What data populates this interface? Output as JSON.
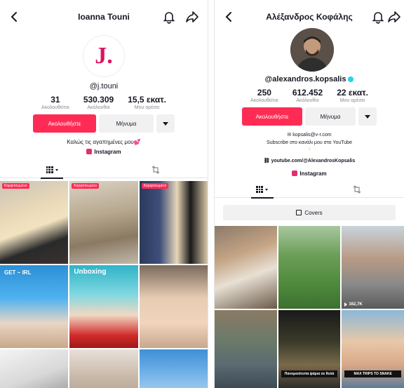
{
  "left": {
    "title": "Ioanna Touni",
    "avatar_letter": "J.",
    "handle": "@j.touni",
    "stats": [
      {
        "num": "31",
        "lbl": "Ακολουθείται"
      },
      {
        "num": "530.309",
        "lbl": "Ακόλουθοι"
      },
      {
        "num": "15,5 εκατ.",
        "lbl": "Μου αρέσει"
      }
    ],
    "follow_label": "Ακολουθήστε",
    "message_label": "Μήνυμα",
    "bio": "Καλώς τις αγαπημένες μου💕",
    "instagram_label": "Instagram",
    "tiles": [
      {
        "badge": "Καρφιτσωμένο",
        "views": "",
        "caption": ""
      },
      {
        "badge": "Καρφιτσωμένο",
        "views": "",
        "caption": ""
      },
      {
        "badge": "Καρφιτσωμένο",
        "views": "",
        "caption": ""
      },
      {
        "badge": "",
        "views": "",
        "caption": "GET ~ IRL"
      },
      {
        "badge": "",
        "views": "",
        "caption": "Unboxing"
      },
      {
        "badge": "",
        "views": "",
        "caption": ""
      },
      {
        "badge": "",
        "views": "",
        "caption": ""
      },
      {
        "badge": "",
        "views": "",
        "caption": ""
      },
      {
        "badge": "",
        "views": "",
        "caption": ""
      }
    ]
  },
  "right": {
    "title": "Αλέξανδρος Κοφάλης",
    "handle": "@alexandros.kopsalis",
    "stats": [
      {
        "num": "250",
        "lbl": "Ακολουθείται"
      },
      {
        "num": "612.452",
        "lbl": "Ακόλουθοι"
      },
      {
        "num": "22 εκατ.",
        "lbl": "Μου αρέσει"
      }
    ],
    "follow_label": "Ακολουθήστε",
    "message_label": "Μήνυμα",
    "bio_email": "kopsalis@v-r.com",
    "bio_line2": "Subscribe στο κανάλι μου στο YouTube",
    "link": "youtube.com/@AlexandrosKopsalis",
    "instagram_label": "Instagram",
    "covers_label": "Covers",
    "tiles": [
      {
        "views": "",
        "caption": ""
      },
      {
        "views": "",
        "caption": ""
      },
      {
        "views": "162,7K",
        "caption": ""
      },
      {
        "views": "",
        "caption": ""
      },
      {
        "views": "",
        "caption": "Πανομοιότυπα ψάρια σε θολά"
      },
      {
        "views": "",
        "caption": "MAX TRIPS TO SNAKE"
      }
    ]
  },
  "colors": {
    "accent": "#fe2c55",
    "verified": "#20d5ec",
    "brand_pink": "#e0115f"
  }
}
